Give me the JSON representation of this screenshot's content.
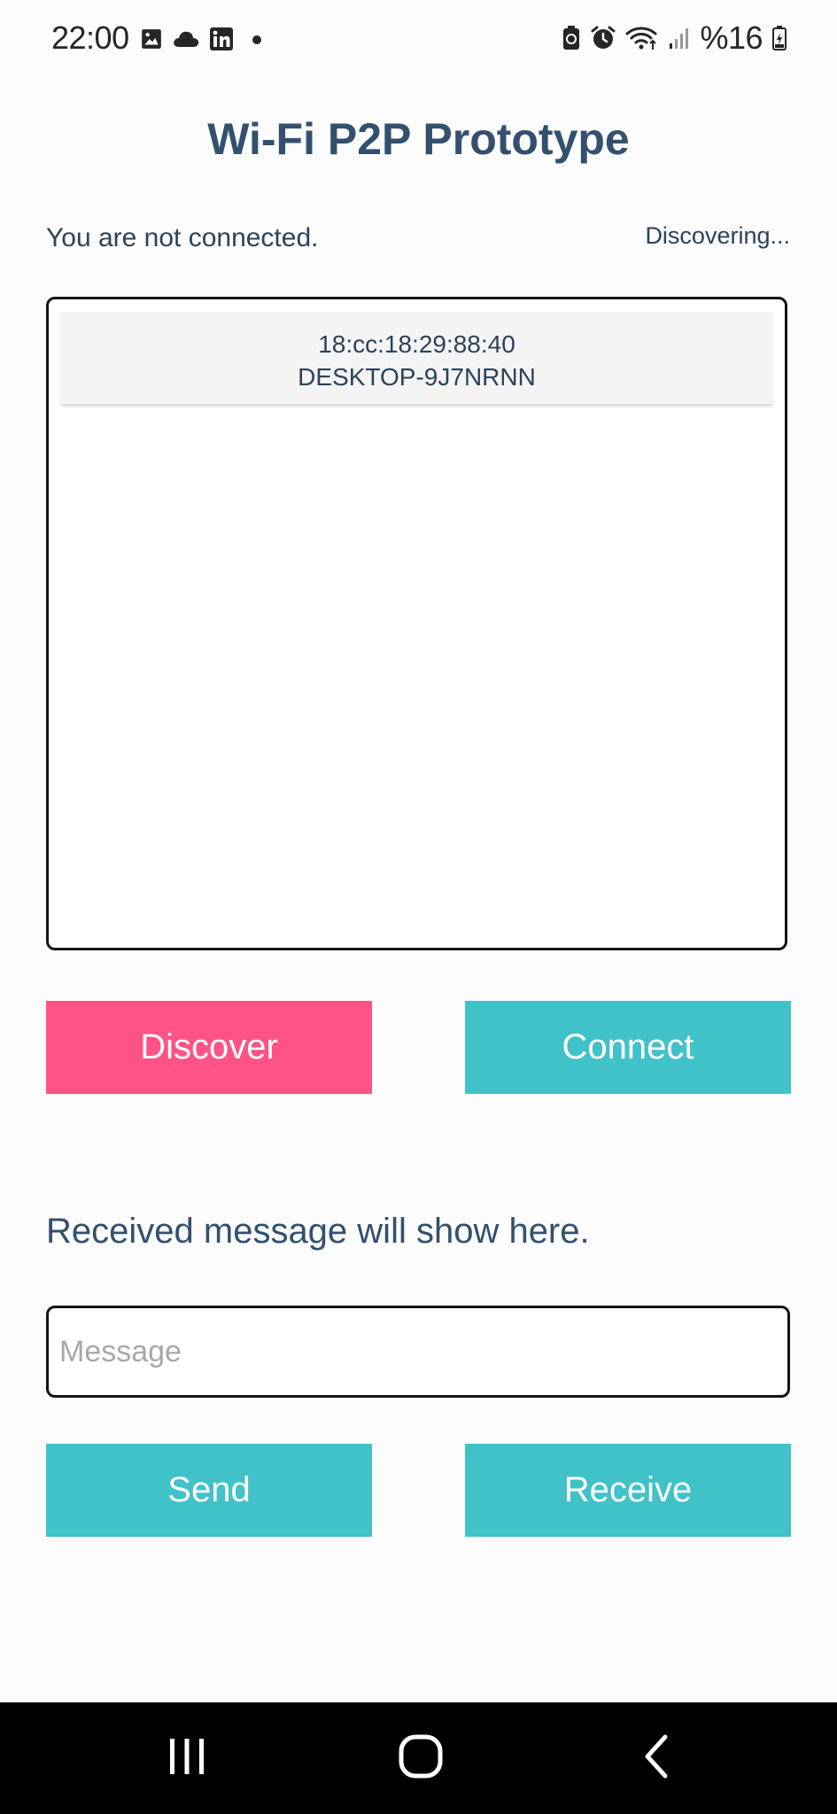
{
  "status_bar": {
    "time": "22:00",
    "battery": "%16",
    "left_icons": [
      "image-icon",
      "cloud-icon",
      "linkedin-icon",
      "dot-icon"
    ],
    "right_icons": [
      "battery-saver-icon",
      "alarm-icon",
      "wifi-icon",
      "signal-icon",
      "battery-icon"
    ]
  },
  "app": {
    "title": "Wi-Fi P2P Prototype",
    "connection_status": "You are not connected.",
    "discovery_status": "Discovering..."
  },
  "peers": [
    {
      "address": "18:cc:18:29:88:40",
      "name": "DESKTOP-9J7NRNN"
    }
  ],
  "buttons": {
    "discover": "Discover",
    "connect": "Connect",
    "send": "Send",
    "receive": "Receive"
  },
  "received_message": "Received message will show here.",
  "message_input": {
    "placeholder": "Message",
    "value": ""
  },
  "nav": {
    "icons": [
      "recents-icon",
      "home-icon",
      "back-icon"
    ]
  },
  "colors": {
    "title": "#33506e",
    "discover_button": "#ff5286",
    "accent_button": "#41c2c9",
    "nav_bar": "#000000"
  }
}
